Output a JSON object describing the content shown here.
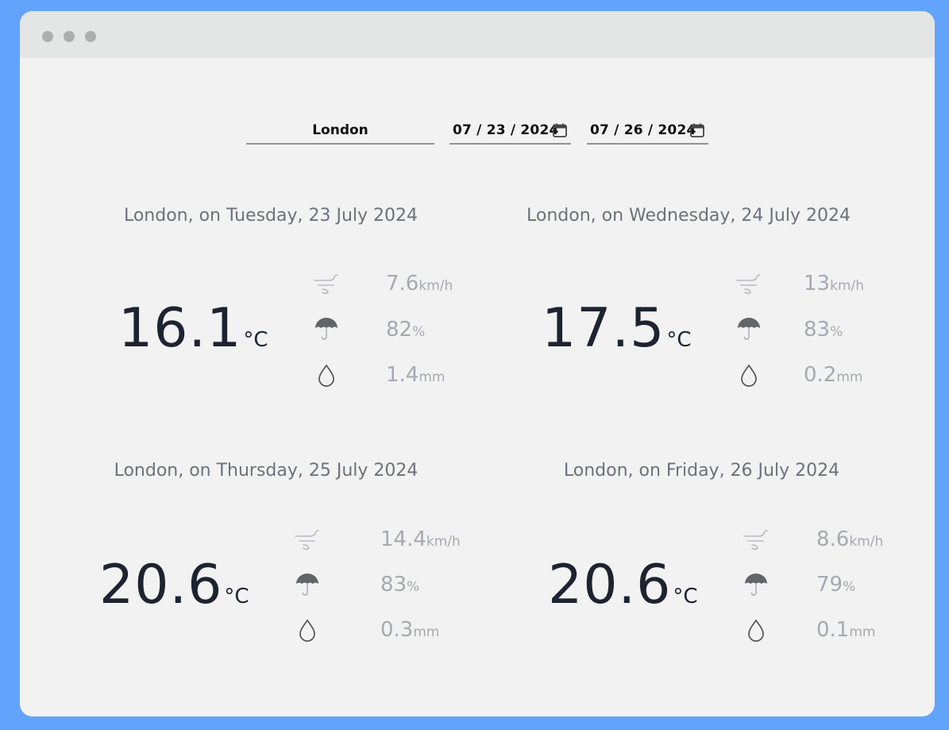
{
  "search": {
    "city": "London",
    "start_date": "07 / 23 / 2024",
    "end_date": "07 / 26 / 2024"
  },
  "icons": {
    "wind": "wind-icon",
    "rain_chance": "umbrella-icon",
    "precipitation": "drop-icon",
    "calendar": "calendar-icon"
  },
  "colors": {
    "page_background": "#62a4fc",
    "window_background": "#f2f2f2",
    "temperature_text": "#1e2330",
    "metric_text": "#a6a9b0"
  },
  "cards": [
    {
      "title": "London, on Tuesday, 23 July 2024",
      "temperature": "16.1",
      "temp_unit": "°C",
      "wind": "7.6",
      "wind_unit": "km/h",
      "humidity": "82",
      "humidity_unit": "%",
      "precip": "1.4",
      "precip_unit": "mm"
    },
    {
      "title": "London, on Wednesday, 24 July 2024",
      "temperature": "17.5",
      "temp_unit": "°C",
      "wind": "13",
      "wind_unit": "km/h",
      "humidity": "83",
      "humidity_unit": "%",
      "precip": "0.2",
      "precip_unit": "mm"
    },
    {
      "title": "London, on Thursday, 25 July 2024",
      "temperature": "20.6",
      "temp_unit": "°C",
      "wind": "14.4",
      "wind_unit": "km/h",
      "humidity": "83",
      "humidity_unit": "%",
      "precip": "0.3",
      "precip_unit": "mm"
    },
    {
      "title": "London, on Friday, 26 July 2024",
      "temperature": "20.6",
      "temp_unit": "°C",
      "wind": "8.6",
      "wind_unit": "km/h",
      "humidity": "79",
      "humidity_unit": "%",
      "precip": "0.1",
      "precip_unit": "mm"
    }
  ]
}
